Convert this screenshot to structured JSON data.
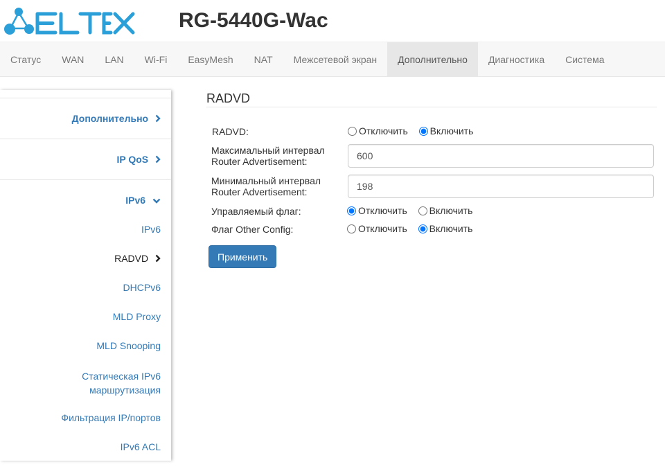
{
  "header": {
    "brand": "ELTEX",
    "model": "RG-5440G-Wac"
  },
  "nav": {
    "tabs": [
      {
        "label": "Статус"
      },
      {
        "label": "WAN"
      },
      {
        "label": "LAN"
      },
      {
        "label": "Wi-Fi"
      },
      {
        "label": "EasyMesh"
      },
      {
        "label": "NAT"
      },
      {
        "label": "Межсетевой экран"
      },
      {
        "label": "Дополнительно",
        "active": true
      },
      {
        "label": "Диагностика"
      },
      {
        "label": "Система"
      }
    ]
  },
  "sidebar": {
    "sections": [
      {
        "label": "Дополнительно",
        "icon": "chevron-right-icon"
      },
      {
        "label": "IP QoS",
        "icon": "chevron-right-icon"
      },
      {
        "label": "IPv6",
        "icon": "chevron-down-icon"
      }
    ],
    "items": [
      {
        "label": "IPv6"
      },
      {
        "label": "RADVD",
        "current": true,
        "icon": "chevron-right-icon"
      },
      {
        "label": "DHCPv6"
      },
      {
        "label": "MLD Proxy"
      },
      {
        "label": "MLD Snooping"
      },
      {
        "label": "Статическая IPv6",
        "label2": "маршрутизация"
      },
      {
        "label": "Фильтрация IP/портов"
      },
      {
        "label": "IPv6 ACL"
      }
    ]
  },
  "main": {
    "title": "RADVD",
    "radvd": {
      "label": "RADVD:",
      "off": "Отключить",
      "on": "Включить",
      "selected": "on"
    },
    "max_interval": {
      "label1": "Максимальный интервал",
      "label2": "Router Advertisement:",
      "value": "600"
    },
    "min_interval": {
      "label1": "Минимальный интервал",
      "label2": "Router Advertisement:",
      "value": "198"
    },
    "managed_flag": {
      "label": "Управляемый флаг:",
      "off": "Отключить",
      "on": "Включить",
      "selected": "off"
    },
    "other_flag": {
      "label": "Флаг Other Config:",
      "off": "Отключить",
      "on": "Включить",
      "selected": "on"
    },
    "apply_label": "Применить"
  },
  "colors": {
    "link": "#337ab7",
    "brand": "#2b9fd8",
    "button": "#337ab7"
  }
}
